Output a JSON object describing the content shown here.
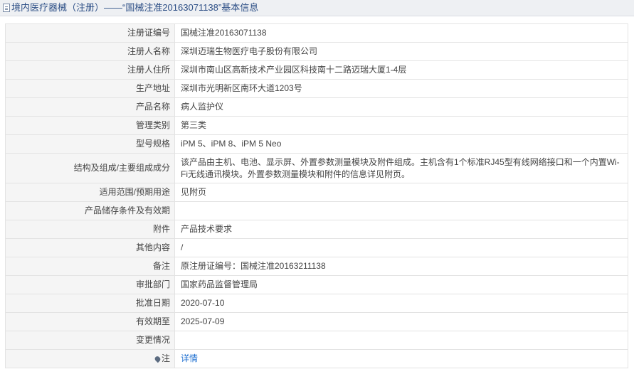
{
  "header": {
    "title": "境内医疗器械（注册）——“国械注准20163071138”基本信息"
  },
  "rows": [
    {
      "label": "注册证编号",
      "value": "国械注准20163071138"
    },
    {
      "label": "注册人名称",
      "value": "深圳迈瑞生物医疗电子股份有限公司"
    },
    {
      "label": "注册人住所",
      "value": "深圳市南山区高新技术产业园区科技南十二路迈瑞大厦1-4层"
    },
    {
      "label": "生产地址",
      "value": "深圳市光明新区南环大道1203号"
    },
    {
      "label": "产品名称",
      "value": "病人监护仪"
    },
    {
      "label": "管理类别",
      "value": "第三类"
    },
    {
      "label": "型号规格",
      "value": "iPM 5、iPM 8、iPM 5 Neo"
    },
    {
      "label": "结构及组成/主要组成成分",
      "value": "该产品由主机、电池、显示屏、外置参数测量模块及附件组成。主机含有1个标准RJ45型有线网络接口和一个内置Wi-Fi无线通讯模块。外置参数测量模块和附件的信息详见附页。"
    },
    {
      "label": "适用范围/预期用途",
      "value": "见附页"
    },
    {
      "label": "产品储存条件及有效期",
      "value": ""
    },
    {
      "label": "附件",
      "value": "产品技术要求"
    },
    {
      "label": "其他内容",
      "value": "/"
    },
    {
      "label": "备注",
      "value": "原注册证编号：国械注准20163211138"
    },
    {
      "label": "审批部门",
      "value": "国家药品监督管理局"
    },
    {
      "label": "批准日期",
      "value": "2020-07-10"
    },
    {
      "label": "有效期至",
      "value": "2025-07-09"
    },
    {
      "label": "变更情况",
      "value": ""
    },
    {
      "label": "注",
      "value": "详情"
    }
  ]
}
